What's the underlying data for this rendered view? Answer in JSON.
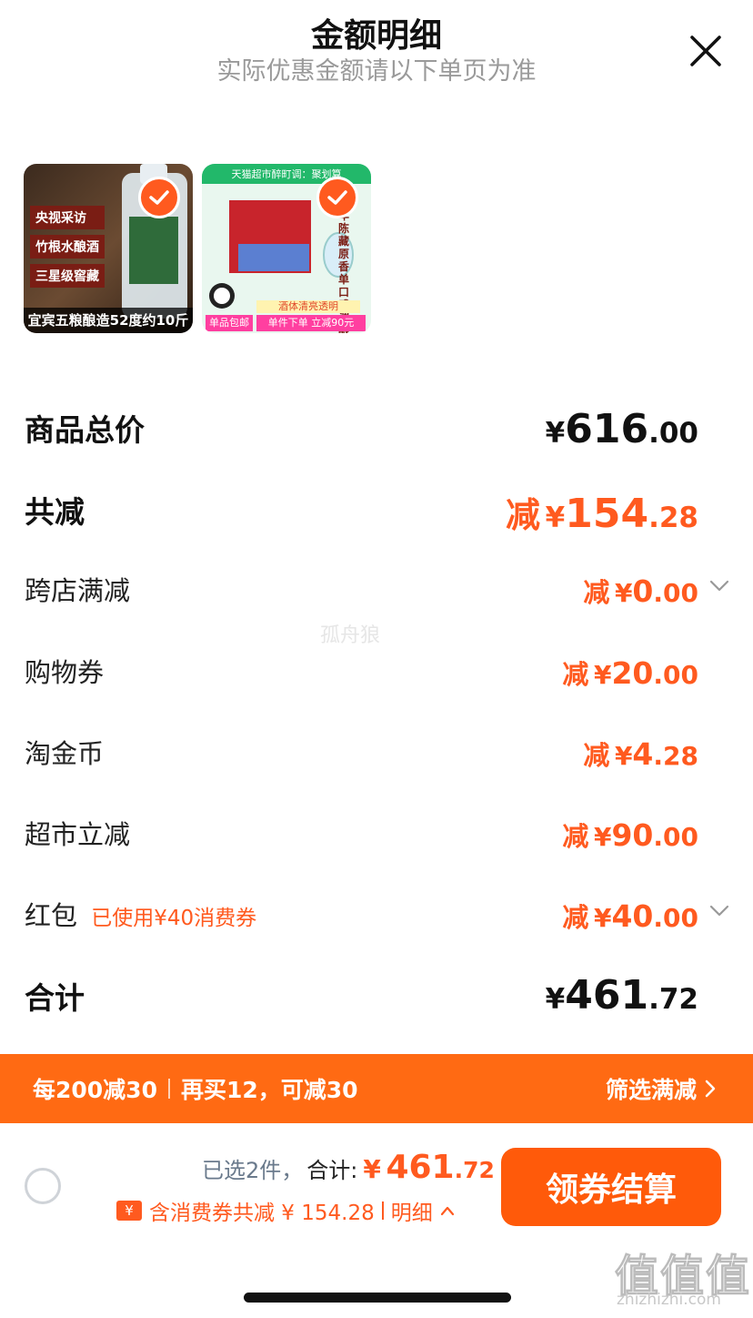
{
  "header": {
    "title": "金额明细",
    "subtitle": "实际优惠金额请以下单页为准"
  },
  "products": [
    {
      "badges": [
        "央视采访",
        "竹根水酿酒",
        "三星级窖藏"
      ],
      "caption": "宜宾五粮酿造52度约10斤"
    },
    {
      "top_text": "天猫超市醉町调：聚划算",
      "side_text": "十年陈藏原香 单口感调酿",
      "strip1": "酒体清亮透明",
      "strip2": "单件下单 立减90元",
      "corner_tag": "单品包邮"
    }
  ],
  "summary": {
    "total_price": {
      "label": "商品总价",
      "yen": "¥",
      "int": "616",
      "dec": ".00"
    },
    "total_reduce": {
      "label": "共减",
      "prefix": "减",
      "yen": "¥",
      "int": "154",
      "dec": ".28"
    },
    "items": [
      {
        "label": "跨店满减",
        "prefix": "减",
        "yen": "¥",
        "int": "0",
        "dec": ".00",
        "expandable": true
      },
      {
        "label": "购物券",
        "prefix": "减",
        "yen": "¥",
        "int": "20",
        "dec": ".00"
      },
      {
        "label": "淘金币",
        "prefix": "减",
        "yen": "¥",
        "int": "4",
        "dec": ".28"
      },
      {
        "label": "超市立减",
        "prefix": "减",
        "yen": "¥",
        "int": "90",
        "dec": ".00"
      },
      {
        "label": "红包",
        "note": "已使用¥40消费券",
        "prefix": "减",
        "yen": "¥",
        "int": "40",
        "dec": ".00",
        "expandable": true
      }
    ],
    "grand_total": {
      "label": "合计",
      "yen": "¥",
      "int": "461",
      "dec": ".72"
    }
  },
  "watermark": "孤舟狼",
  "promo_banner": {
    "left_a": "每200减30",
    "left_b": "再买12，可减30",
    "right": "筛选满减"
  },
  "checkout": {
    "selected_text": "已选2件，",
    "total_label": "合计:",
    "yen": "¥",
    "int": "461",
    "dec": ".72",
    "coupon_icon": "¥",
    "coupon_text": "含消费券共减 ¥ 154.28",
    "detail_link": "明细",
    "button": "领券结算"
  },
  "site_watermark": {
    "logo": "值值值",
    "url": "zhizhizhi.com"
  },
  "colors": {
    "accent": "#ff5a1f",
    "banner": "#ff6a13",
    "button": "#ff5a0a"
  }
}
